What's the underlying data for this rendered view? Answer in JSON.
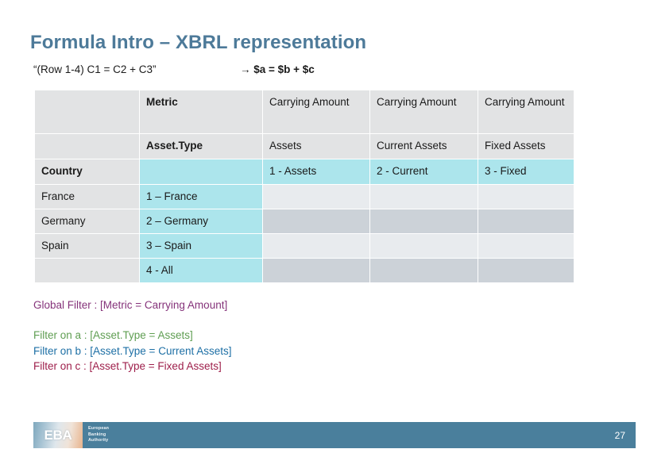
{
  "slide": {
    "title": "Formula Intro – XBRL representation",
    "subtitle_left": "“(Row 1-4) C1 = C2 + C3”",
    "subtitle_right": "→ $a = $b + $c"
  },
  "colors": {
    "title": "#4d7a99",
    "purple": "#85337a",
    "green": "#5f9e52",
    "blue": "#1d6fa5",
    "maroon": "#9e1f4b",
    "cyan_cell": "#ace5ec",
    "gray_header": "#e2e3e4",
    "gray_light": "#e8ebee",
    "gray_dark": "#ccd2d8",
    "footer": "#4a7f9c"
  },
  "table": {
    "metric_row": {
      "corner": "",
      "label": "Metric",
      "c1": "Carrying Amount",
      "c2": "Carrying Amount",
      "c3": "Carrying Amount"
    },
    "assettype_row": {
      "corner": "",
      "label": "Asset.Type",
      "c1": "Assets",
      "c2": "Current Assets",
      "c3": "Fixed Assets"
    },
    "country_row": {
      "label": "Country",
      "b": "",
      "c1": "1 - Assets",
      "c2": "2 - Current",
      "c3": "3 - Fixed"
    },
    "data_rows": [
      {
        "country": "France",
        "code": "1 – France",
        "c1": "",
        "c2": "",
        "c3": ""
      },
      {
        "country": "Germany",
        "code": "2 – Germany",
        "c1": "",
        "c2": "",
        "c3": ""
      },
      {
        "country": "Spain",
        "code": "3 – Spain",
        "c1": "",
        "c2": "",
        "c3": ""
      },
      {
        "country": "",
        "code": "4 -  All",
        "c1": "",
        "c2": "",
        "c3": ""
      }
    ]
  },
  "filters": {
    "global": "Global Filter : [Metric = Carrying Amount]",
    "a": "Filter on a : [Asset.Type = Assets]",
    "b": "Filter on b : [Asset.Type = Current Assets]",
    "c": "Filter on c : [Asset.Type = Fixed Assets]"
  },
  "footer": {
    "logo_text": "EBA",
    "logo_subtitle_line1": "European",
    "logo_subtitle_line2": "Banking",
    "logo_subtitle_line3": "Authority",
    "page_number": "27"
  }
}
